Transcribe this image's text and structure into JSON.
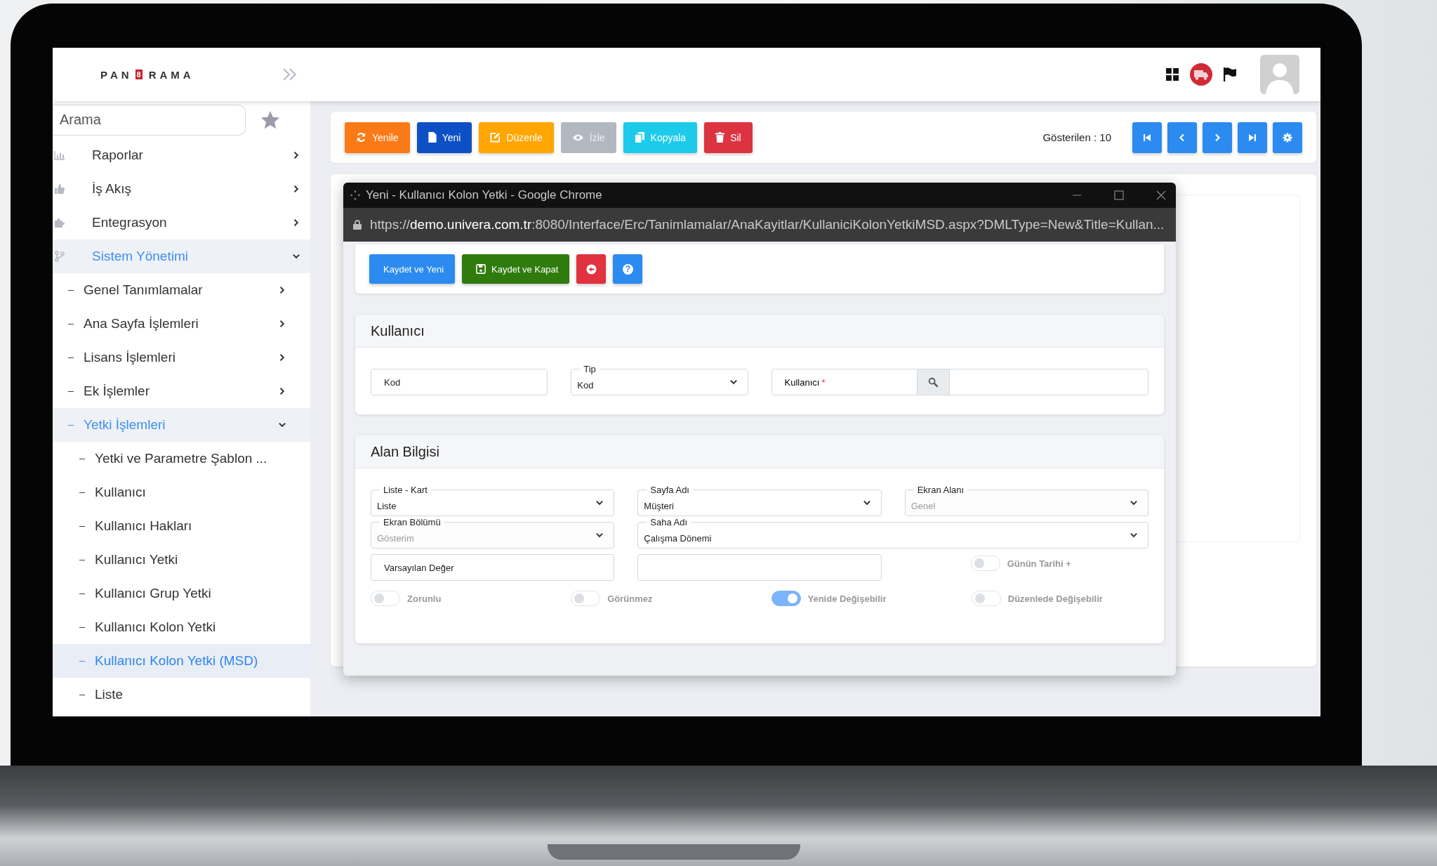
{
  "header": {
    "logo": {
      "before": "PAN",
      "mark": "8",
      "after": "RAMA"
    }
  },
  "sidebar": {
    "search": {
      "placeholder": "Arama"
    },
    "items": [
      {
        "label": "Raporlar",
        "kind": "chart",
        "expanded": false,
        "selected": false
      },
      {
        "label": "İş Akış",
        "kind": "thumb",
        "expanded": false,
        "selected": false
      },
      {
        "label": "Entegrasyon",
        "kind": "puzzle",
        "expanded": false,
        "selected": false
      },
      {
        "label": "Sistem Yönetimi",
        "kind": "branch",
        "expanded": true,
        "selected": false,
        "children": [
          {
            "label": "Genel Tanımlamalar",
            "expanded": false,
            "selected": false
          },
          {
            "label": "Ana Sayfa İşlemleri",
            "expanded": false,
            "selected": false
          },
          {
            "label": "Lisans İşlemleri",
            "expanded": false,
            "selected": false
          },
          {
            "label": "Ek İşlemler",
            "expanded": false,
            "selected": false
          },
          {
            "label": "Yetki İşlemleri",
            "expanded": true,
            "selected": false,
            "children": [
              {
                "label": "Yetki ve Parametre Şablon ...",
                "selected": false
              },
              {
                "label": "Kullanıcı",
                "selected": false
              },
              {
                "label": "Kullanıcı Hakları",
                "selected": false
              },
              {
                "label": "Kullanıcı Yetki",
                "selected": false
              },
              {
                "label": "Kullanıcı Grup Yetki",
                "selected": false
              },
              {
                "label": "Kullanıcı Kolon Yetki",
                "selected": false
              },
              {
                "label": "Kullanıcı Kolon Yetki (MSD)",
                "selected": true
              },
              {
                "label": "Liste",
                "selected": false
              }
            ]
          }
        ]
      }
    ]
  },
  "toolbar": {
    "buttons": [
      {
        "label": "Yenile",
        "kind": "refresh",
        "color": "#fb7a17",
        "disabled": false
      },
      {
        "label": "Yeni",
        "kind": "file",
        "color": "#0d50c6",
        "disabled": false
      },
      {
        "label": "Düzenle",
        "kind": "edit",
        "color": "#ffa602",
        "disabled": false
      },
      {
        "label": "İzle",
        "kind": "eye",
        "color": "#b1b8c0",
        "disabled": true
      },
      {
        "label": "Kopyala",
        "kind": "copy",
        "color": "#1ccbea",
        "disabled": false
      },
      {
        "label": "Sil",
        "kind": "trash",
        "color": "#dc3341",
        "disabled": false
      }
    ],
    "count_label": "Gösterilen : 10",
    "nav": [
      {
        "kind": "first"
      },
      {
        "kind": "prev"
      },
      {
        "kind": "next"
      },
      {
        "kind": "last"
      },
      {
        "kind": "settings"
      }
    ]
  },
  "modal": {
    "title": "Yeni - Kullanıcı Kolon Yetki - Google Chrome",
    "url": "https://**demo.univera.com.tr**:8080/Interface/Erc/Tanimlamalar/AnaKayitlar/KullaniciKolonYetkiMSD.aspx?DMLType=New&Title=Kullan...",
    "buttons": [
      {
        "kind": "text",
        "label": "Kaydet ve Yeni",
        "color": "#2b8bf0"
      },
      {
        "kind": "save",
        "label": "Kaydet ve Kapat",
        "color": "#2f7b0e"
      },
      {
        "kind": "back",
        "color": "#e0323f"
      },
      {
        "kind": "help",
        "symbol": "?",
        "color": "#2b8bf0"
      }
    ],
    "sections": [
      {
        "title": "Kullanıcı",
        "rows": [
          [
            {
              "kind": "text",
              "placeholder": "Kod"
            },
            {
              "kind": "select",
              "label": "Tip",
              "value": "Kod",
              "disabled": false
            },
            {
              "kind": "lookup",
              "label": "Kullanıcı",
              "required_mark": "*"
            }
          ]
        ]
      },
      {
        "title": "Alan Bilgisi",
        "rows": [
          [
            {
              "kind": "select",
              "label": "Liste - Kart",
              "value": "Liste",
              "disabled": false
            },
            {
              "kind": "select",
              "label": "Sayfa Adı",
              "value": "Müşteri",
              "disabled": false
            },
            {
              "kind": "select",
              "label": "Ekran Alanı",
              "value": "Genel",
              "disabled": true
            }
          ],
          [
            {
              "kind": "select",
              "label": "Ekran Bölümü",
              "value": "Gösterim",
              "disabled": true
            },
            {
              "kind": "select",
              "label": "Saha Adı",
              "value": "Çalışma Dönemi",
              "disabled": false
            }
          ],
          [
            {
              "kind": "text",
              "placeholder": "Varsayılan Değer"
            },
            {
              "kind": "text"
            },
            {
              "kind": "toggle",
              "label": "Günün Tarihi +",
              "on": false
            }
          ]
        ],
        "switches": [
          {
            "label": "Zorunlu",
            "on": false
          },
          {
            "label": "Görünmez",
            "on": false
          },
          {
            "label": "Yenide Değişebilir",
            "on": true
          },
          {
            "label": "Düzenlede Değişebilir",
            "on": false
          }
        ]
      }
    ]
  }
}
